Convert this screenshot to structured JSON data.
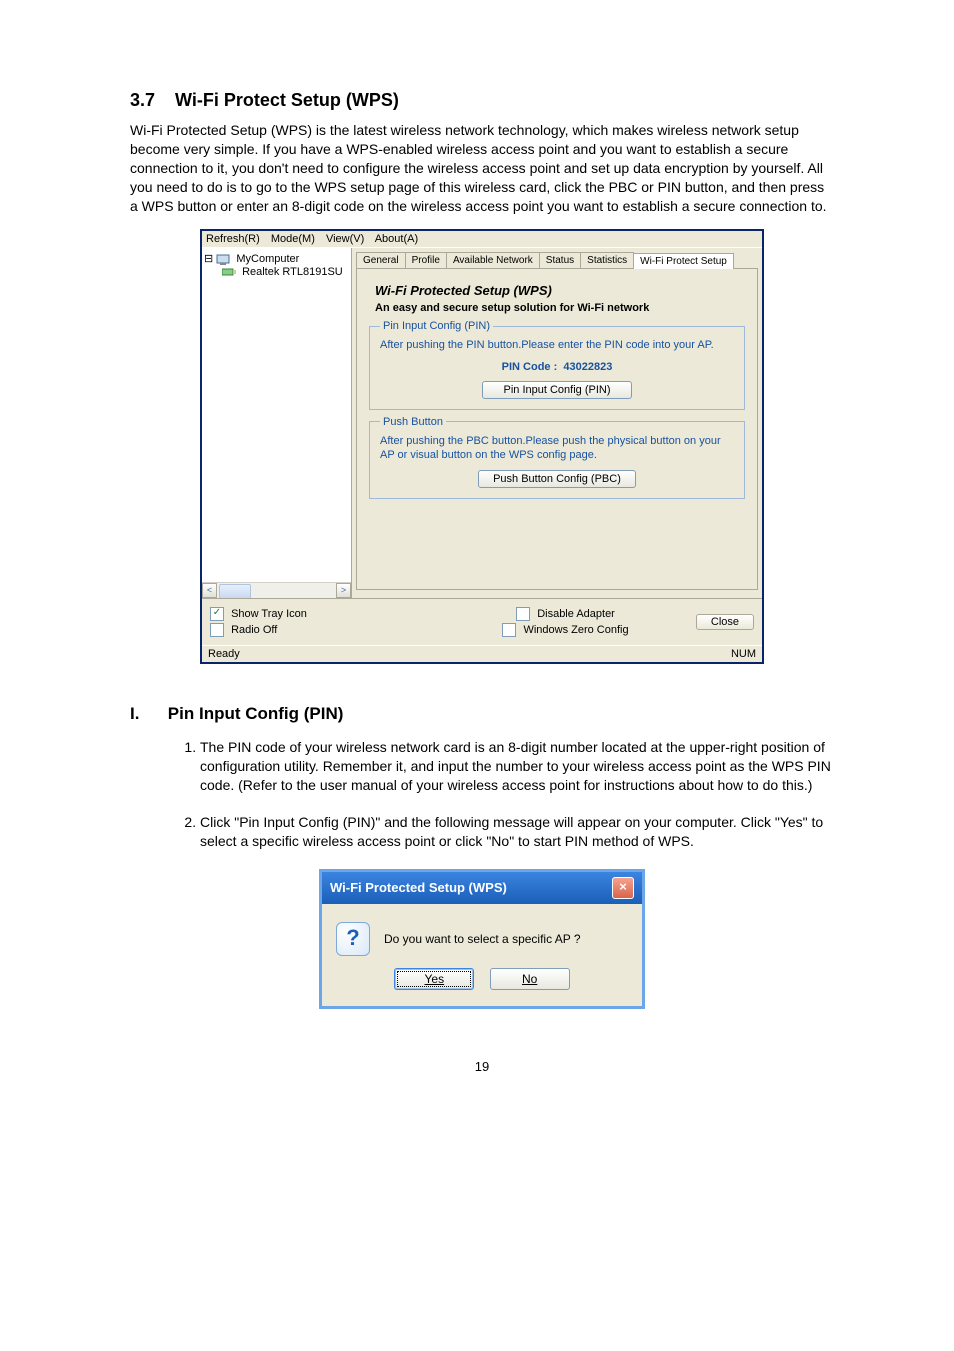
{
  "section_number": "3.7",
  "section_title": "Wi-Fi Protect Setup (WPS)",
  "intro_paragraph": "Wi-Fi Protected Setup (WPS) is the latest wireless network technology, which makes wireless network setup become very simple. If you have a WPS-enabled wireless access point and you want to establish a secure connection to it, you don't need to configure the wireless access point and set up data encryption by yourself. All you need to do is to go to the WPS setup page of this wireless card, click the PBC or PIN button, and then press a WPS button or enter an 8-digit code on the wireless access point you want to establish a secure connection to.",
  "app_window": {
    "menu": {
      "refresh": "Refresh(R)",
      "mode": "Mode(M)",
      "view": "View(V)",
      "about": "About(A)"
    },
    "tree": {
      "root": "MyComputer",
      "child": "Realtek RTL8191SU"
    },
    "tabs": [
      "General",
      "Profile",
      "Available Network",
      "Status",
      "Statistics",
      "Wi-Fi Protect Setup"
    ],
    "wps_title": "Wi-Fi Protected Setup (WPS)",
    "wps_subtitle": "An easy and secure setup solution for Wi-Fi network",
    "pin_group": {
      "legend": "Pin Input Config (PIN)",
      "text": "After pushing the PIN button.Please enter the PIN code into your AP.",
      "pin_label": "PIN Code :",
      "pin_value": "43022823",
      "button": "Pin Input Config (PIN)"
    },
    "pbc_group": {
      "legend": "Push Button",
      "text": "After pushing the PBC button.Please push the physical button on your AP or visual button on the WPS config page.",
      "button": "Push Button Config (PBC)"
    },
    "footer": {
      "show_tray": "Show Tray Icon",
      "radio_off": "Radio Off",
      "disable_adapter": "Disable Adapter",
      "win_zero": "Windows Zero Config",
      "close": "Close"
    },
    "status": {
      "ready": "Ready",
      "num": "NUM"
    }
  },
  "sub_section": {
    "number": "I.",
    "title": "Pin Input Config (PIN)",
    "items": [
      "The PIN code of your wireless network card is an 8-digit number located at the upper-right position of configuration utility. Remember it, and input the number to your wireless access point as the WPS PIN code. (Refer to the user manual of your wireless access point for instructions about how to do this.)",
      "Click \"Pin Input Config (PIN)\" and the following message will appear on your computer. Click \"Yes\" to select a specific wireless access point or click \"No\" to start PIN method of WPS."
    ]
  },
  "dialog": {
    "title": "Wi-Fi Protected Setup (WPS)",
    "message": "Do you want to select a specific AP ?",
    "yes": "Yes",
    "no": "No"
  },
  "page_number": "19"
}
